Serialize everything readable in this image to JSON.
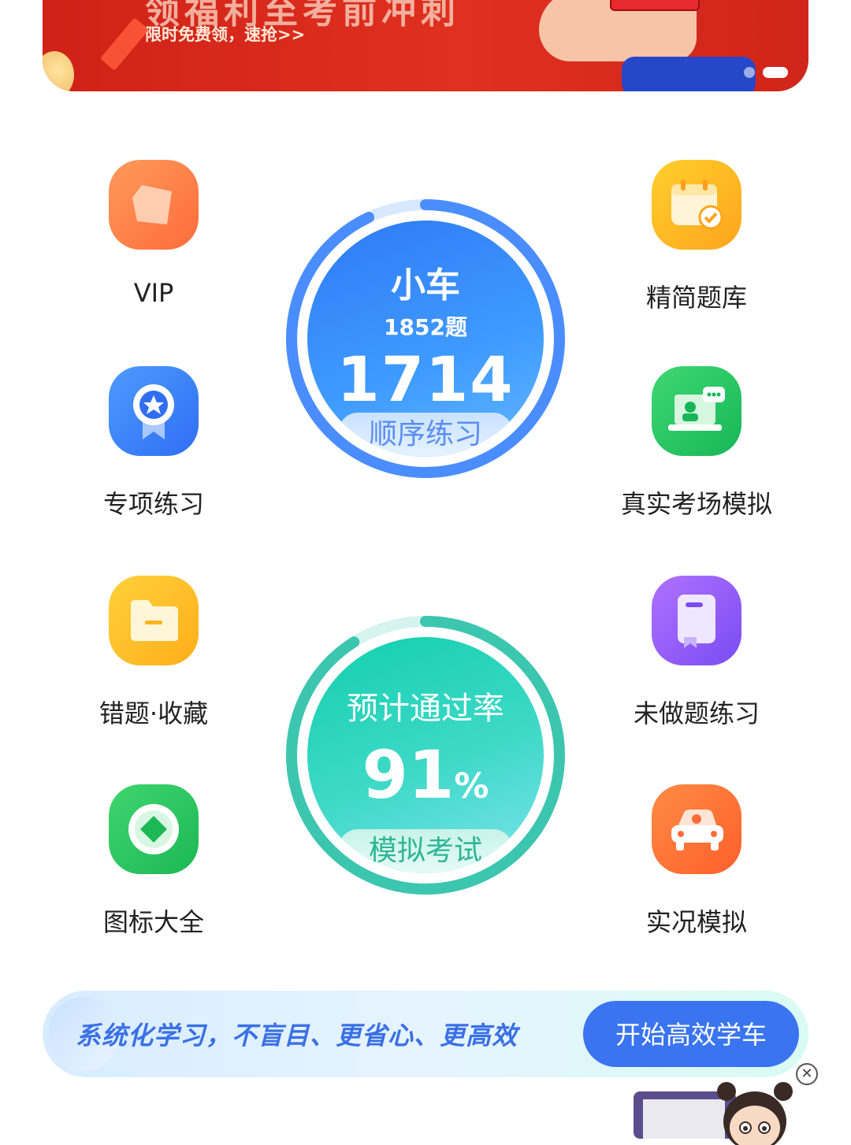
{
  "banner": {
    "headline": "领福利至考前冲刺",
    "subtitle": "限时免费领，速抢>>",
    "pages": 2,
    "active_page": 2
  },
  "left_items": [
    {
      "label": "VIP",
      "icon": "vip-gem-icon"
    },
    {
      "label": "专项练习",
      "icon": "medal-icon"
    },
    {
      "label": "错题·收藏",
      "icon": "folder-icon"
    },
    {
      "label": "图标大全",
      "icon": "diamond-coin-icon"
    }
  ],
  "right_items": [
    {
      "label": "精简题库",
      "icon": "calendar-check-icon"
    },
    {
      "label": "真实考场模拟",
      "icon": "laptop-exam-icon"
    },
    {
      "label": "未做题练习",
      "icon": "notebook-icon"
    },
    {
      "label": "实况模拟",
      "icon": "car-icon"
    }
  ],
  "sequential": {
    "vehicle": "小车",
    "total": "1852题",
    "count": "1714",
    "action": "顺序练习",
    "progress": 0.93
  },
  "exam": {
    "caption": "预计通过率",
    "rate": "91",
    "unit": "%",
    "action": "模拟考试",
    "progress": 0.91
  },
  "promo": {
    "slogan": "系统化学习，不盲目、更省心、更高效",
    "cta": "开始高效学车",
    "close": "✕"
  },
  "colors": {
    "brand_blue": "#3a74f0",
    "banner_red": "#d8281c",
    "teal": "#26cfae"
  }
}
